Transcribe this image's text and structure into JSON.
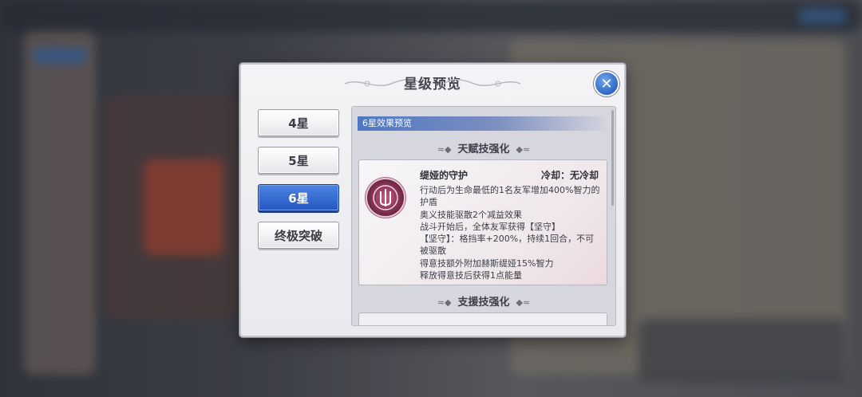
{
  "dialog": {
    "title": "星级预览",
    "close_label": "✕"
  },
  "star_tabs": [
    {
      "label": "4星",
      "active": false
    },
    {
      "label": "5星",
      "active": false
    },
    {
      "label": "6星",
      "active": true
    },
    {
      "label": "终极突破",
      "active": false
    }
  ],
  "panel": {
    "header": "6星效果预览",
    "sections": [
      {
        "title": "天赋技强化"
      },
      {
        "title": "支援技强化"
      }
    ],
    "skill": {
      "name": "缇娅的守护",
      "cooldown": "冷却：无冷却",
      "description": [
        "行动后为生命最低的1名友军增加400%智力的护盾",
        "奥义技能驱散2个减益效果",
        "战斗开始后，全体友军获得【坚守】",
        "【坚守】：格挡率+200%，持续1回合，不可被驱散",
        "得意技额外附加赫斯缇娅15%智力",
        "释放得意技后获得1点能量"
      ],
      "icon": "skill-shield-icon"
    }
  },
  "colors": {
    "accent": "#2f66c4",
    "active_tab": "#3b6fd3",
    "header_bar": "#4f77c2"
  }
}
